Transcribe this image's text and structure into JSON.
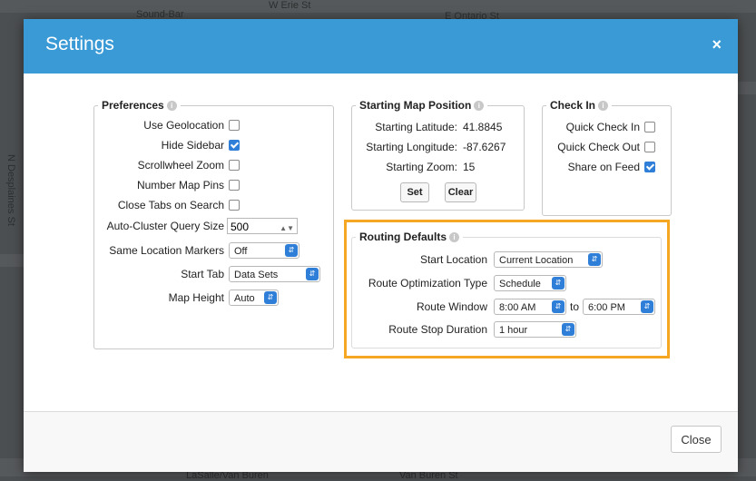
{
  "map": {
    "labels": [
      "Sound-Bar",
      "W Erie St",
      "E Ontario St",
      "N Desplaines St",
      "LaSalle/Van Buren",
      "Van Buren St"
    ]
  },
  "modal": {
    "title": "Settings",
    "close_icon": "×",
    "footer_close": "Close"
  },
  "preferences": {
    "legend": "Preferences",
    "use_geolocation": {
      "label": "Use Geolocation",
      "checked": false
    },
    "hide_sidebar": {
      "label": "Hide Sidebar",
      "checked": true
    },
    "scrollwheel_zoom": {
      "label": "Scrollwheel Zoom",
      "checked": false
    },
    "number_map_pins": {
      "label": "Number Map Pins",
      "checked": false
    },
    "close_tabs_on_search": {
      "label": "Close Tabs on Search",
      "checked": false
    },
    "auto_cluster": {
      "label": "Auto-Cluster Query Size",
      "value": "500"
    },
    "same_location_markers": {
      "label": "Same Location Markers",
      "value": "Off"
    },
    "start_tab": {
      "label": "Start Tab",
      "value": "Data Sets"
    },
    "map_height": {
      "label": "Map Height",
      "value": "Auto"
    }
  },
  "starting_position": {
    "legend": "Starting Map Position",
    "latitude_label": "Starting Latitude:",
    "latitude_value": "41.8845",
    "longitude_label": "Starting Longitude:",
    "longitude_value": "-87.6267",
    "zoom_label": "Starting Zoom:",
    "zoom_value": "15",
    "set_button": "Set",
    "clear_button": "Clear"
  },
  "check_in": {
    "legend": "Check In",
    "quick_check_in": {
      "label": "Quick Check In",
      "checked": false
    },
    "quick_check_out": {
      "label": "Quick Check Out",
      "checked": false
    },
    "share_on_feed": {
      "label": "Share on Feed",
      "checked": true
    }
  },
  "routing": {
    "legend": "Routing Defaults",
    "start_location": {
      "label": "Start Location",
      "value": "Current Location"
    },
    "optimization_type": {
      "label": "Route Optimization Type",
      "value": "Schedule"
    },
    "route_window": {
      "label": "Route Window",
      "from": "8:00 AM",
      "to_word": "to",
      "to": "6:00 PM"
    },
    "stop_duration": {
      "label": "Route Stop Duration",
      "value": "1 hour"
    }
  },
  "colors": {
    "header": "#3a9ad6",
    "accent": "#2f7fd9",
    "highlight": "#f5a623"
  }
}
